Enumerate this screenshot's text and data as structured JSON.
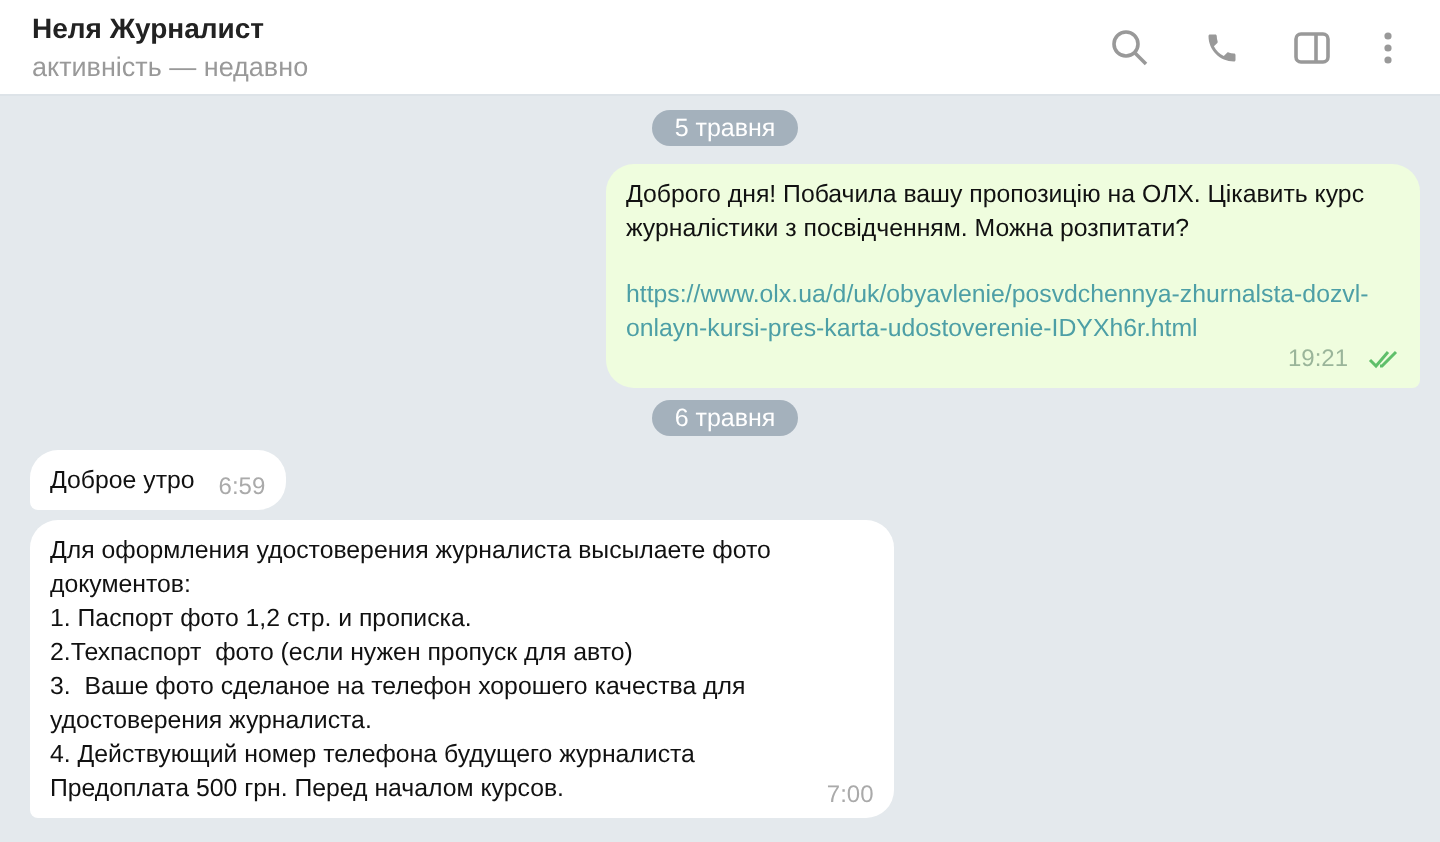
{
  "header": {
    "title": "Неля Журналист",
    "status": "активність — недавно"
  },
  "messages": [
    {
      "kind": "date",
      "text": "5 травня"
    },
    {
      "kind": "outgoing",
      "text": "Доброго дня! Побачила вашу пропозицію на ОЛХ. Цікавить курс\nжурналістики з посвідченням. Можна розпитати?",
      "link": "https://www.olx.ua/d/uk/obyavlenie/posvdchennya-zhurnalsta-dozvl-onlayn-kursi-pres-karta-udostoverenie-IDYXh6r.html",
      "time": "19:21",
      "read": true
    },
    {
      "kind": "date",
      "text": "6 травня"
    },
    {
      "kind": "incoming",
      "text": "Доброе утро",
      "time": "6:59"
    },
    {
      "kind": "incoming",
      "text": "Для оформления удостоверения журналиста высылаете фото\nдокументов:\n1. Паспорт фото 1,2 стр. и прописка.\n2.Техпаспорт  фото (если нужен пропуск для авто)\n3.  Ваше фото сделаное на телефон хорошего качества для\nудостоверения журналиста.\n4. Действующий номер телефона будущего журналиста\nПредоплата 500 грн. Перед началом курсов.",
      "time": "7:00"
    }
  ]
}
